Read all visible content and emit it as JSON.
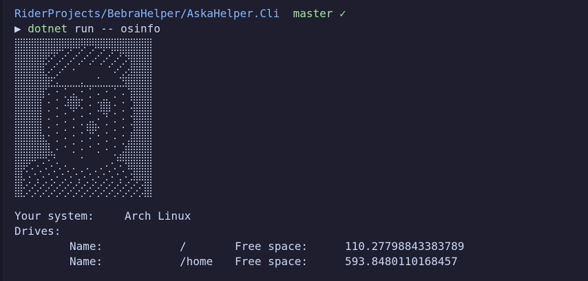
{
  "prompt": {
    "path": "RiderProjects/BebraHelper/AskaHelper.Cli",
    "branch": "master",
    "branch_status_icon": "check-icon",
    "branch_status_glyph": "✓",
    "prompt_glyph": "▶",
    "command": "dotnet",
    "arguments": "run -- osinfo"
  },
  "output": {
    "ascii_art_name": "braille-portrait-art",
    "system_label": "Your system:",
    "system_value": "Arch Linux",
    "drives_label": "Drives:",
    "drives": [
      {
        "name_label": "Name:",
        "name": "/",
        "free_label": "Free space:",
        "free": "110.27798843383789"
      },
      {
        "name_label": "Name:",
        "name": "/home",
        "free_label": "Free space:",
        "free": "593.8480110168457"
      }
    ]
  },
  "colors": {
    "background": "#1e1e2e",
    "path": "#89b4fa",
    "branch": "#a6e3a1",
    "text": "#cdd6f4"
  }
}
